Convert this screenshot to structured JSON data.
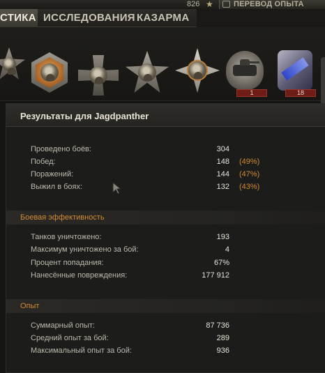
{
  "topbar": {
    "xp_count": "826",
    "star_icon": "star-icon",
    "transfer_label": "ПЕРЕВОД ОПЫТА"
  },
  "nav": {
    "tabs": [
      {
        "label": "СТИКА",
        "active": true
      },
      {
        "label": "ИССЛЕДОВАНИЯ",
        "active": false
      },
      {
        "label": "КАЗАРМА",
        "active": false
      }
    ]
  },
  "achievements": {
    "medals": [
      "star-medal-icon",
      "hex-medal-icon",
      "cross-medal-icon",
      "star-medal-icon",
      "gold-star-medal-icon",
      "tank-badge-icon",
      "ribbon-badge-icon"
    ],
    "counts": [
      "1",
      "18"
    ]
  },
  "results": {
    "title": "Результаты для Jagdpanther",
    "battles": [
      {
        "label": "Проведено боёв:",
        "value": "304",
        "pct": ""
      },
      {
        "label": "Побед:",
        "value": "148",
        "pct": "(49%)"
      },
      {
        "label": "Поражений:",
        "value": "144",
        "pct": "(47%)"
      },
      {
        "label": "Выжил в боях:",
        "value": "132",
        "pct": "(43%)"
      }
    ],
    "combat_title": "Боевая эффективность",
    "combat": [
      {
        "label": "Танков уничтожено:",
        "value": "193"
      },
      {
        "label": "Максимум уничтожено за бой:",
        "value": "4"
      },
      {
        "label": "Процент попадания:",
        "value": "67%"
      },
      {
        "label": "Нанесённые повреждения:",
        "value": "177 912"
      }
    ],
    "xp_title": "Опыт",
    "xp": [
      {
        "label": "Суммарный опыт:",
        "value": "87 736"
      },
      {
        "label": "Средний опыт за бой:",
        "value": "289"
      },
      {
        "label": "Максимальный опыт за бой:",
        "value": "936"
      }
    ]
  },
  "colors": {
    "accent_orange": "#d28a33",
    "background": "#141413",
    "badge_red": "#6e1d16"
  }
}
